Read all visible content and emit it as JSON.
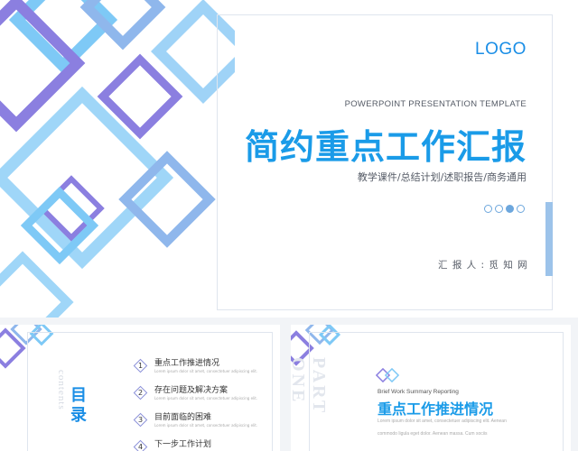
{
  "main_slide": {
    "logo": "LOGO",
    "subtitle_en": "POWERPOINT PRESENTATION TEMPLATE",
    "title": "简约重点工作汇报",
    "tagline": "教学课件/总结计划/述职报告/商务通用",
    "pager": {
      "total": 4,
      "active": 2
    },
    "reporter": "汇 报 人 :  觅 知 网",
    "colors": {
      "accent": "#1a9be8",
      "purple": "#8b7fe0",
      "light_blue": "#7fc8f5"
    }
  },
  "thumbnails": {
    "toc": {
      "title": "目录",
      "vertical_text": "contents",
      "items": [
        {
          "num": "1",
          "label": "重点工作推进情况",
          "desc": "Lorem ipsum dolor sit amet, consectetuer adipiscing elit."
        },
        {
          "num": "2",
          "label": "存在问题及解决方案",
          "desc": "Lorem ipsum dolor sit amet, consectetuer adipiscing elit."
        },
        {
          "num": "3",
          "label": "目前面临的困难",
          "desc": "Lorem ipsum dolor sit amet, consectetuer adipiscing elit."
        },
        {
          "num": "4",
          "label": "下一步工作计划",
          "desc": ""
        }
      ]
    },
    "part": {
      "vertical_text": "PART ONE",
      "kicker": "Brief Work Summary Reporting",
      "title": "重点工作推进情况",
      "lorem": [
        "Lorem ipsum dolor sit amet, consectetuer adipiscing elit. Aenean",
        "commodo ligula eget dolor. Aenean massa. Cum sociis"
      ]
    }
  }
}
